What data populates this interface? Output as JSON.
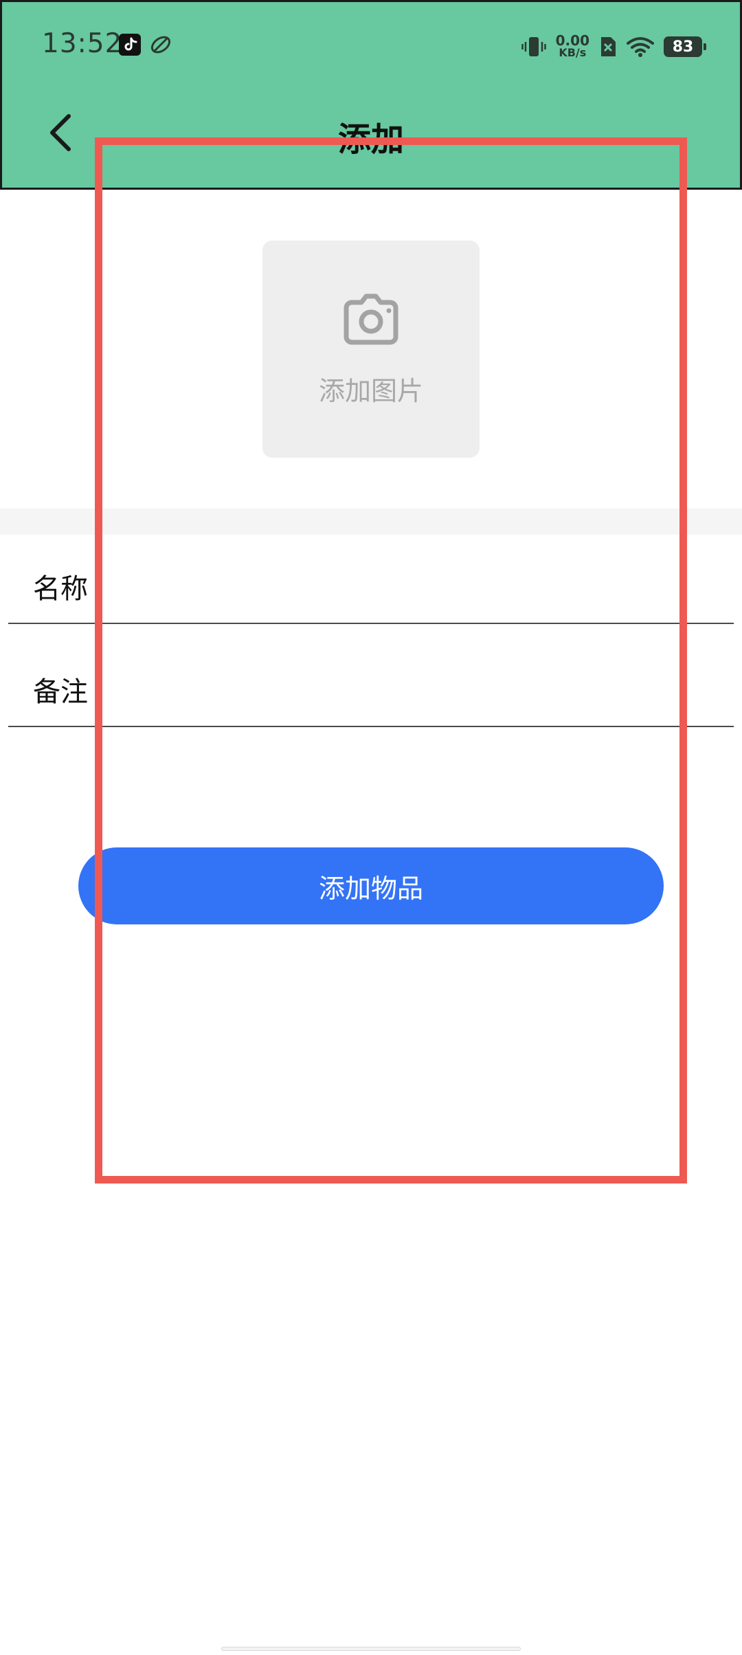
{
  "status_bar": {
    "time": "13:52",
    "net_speed_value": "0.00",
    "net_speed_unit": "KB/s",
    "battery_level": "83",
    "icons": [
      "tiktok-icon",
      "app-leaf-icon",
      "vibrate-icon",
      "sim-no-service-icon",
      "wifi-icon",
      "battery-icon"
    ]
  },
  "toolbar": {
    "title": "添加",
    "back_icon": "chevron-left-icon",
    "background_color": "#68c89f"
  },
  "image_picker": {
    "label": "添加图片",
    "icon": "camera-icon"
  },
  "form": {
    "name_label": "名称",
    "name_value": "",
    "note_label": "备注",
    "note_value": ""
  },
  "submit_button": {
    "label": "添加物品",
    "color": "#3373f6"
  },
  "annotation": {
    "color": "#ee5a52"
  }
}
